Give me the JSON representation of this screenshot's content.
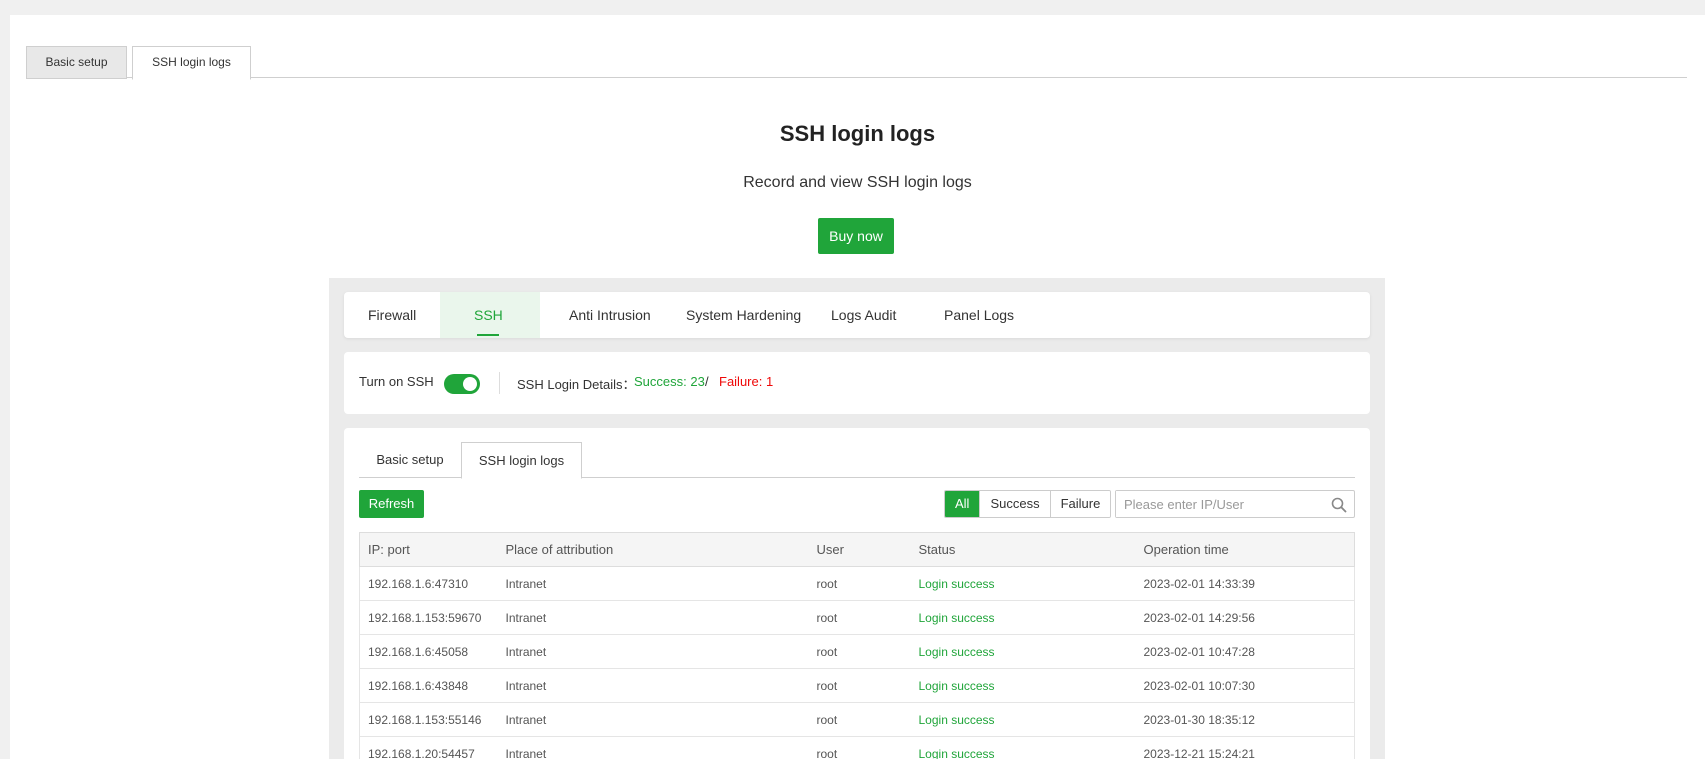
{
  "top_tabs": {
    "basic_setup": "Basic setup",
    "ssh_login_logs": "SSH login logs"
  },
  "hero": {
    "title": "SSH login logs",
    "subtitle": "Record and view SSH login logs",
    "buy_button": "Buy now"
  },
  "nav": {
    "items": [
      "Firewall",
      "SSH",
      "Anti Intrusion",
      "System Hardening",
      "Logs Audit",
      "Panel Logs"
    ],
    "active": "SSH"
  },
  "ssh_status": {
    "toggle_label": "Turn on SSH",
    "toggle_on": true,
    "details_label": "SSH Login Details：",
    "success": "Success: 23",
    "separator": "/",
    "failure": "Failure: 1"
  },
  "inner_tabs": {
    "basic_setup": "Basic setup",
    "ssh_login_logs": "SSH login logs"
  },
  "toolbar": {
    "refresh": "Refresh",
    "filters": [
      "All",
      "Success",
      "Failure"
    ],
    "active_filter": "All",
    "search_placeholder": "Please enter IP/User"
  },
  "table": {
    "headers": [
      "IP: port",
      "Place of attribution",
      "User",
      "Status",
      "Operation time"
    ],
    "rows": [
      [
        "192.168.1.6:47310",
        "Intranet",
        "root",
        "Login success",
        "2023-02-01 14:33:39"
      ],
      [
        "192.168.1.153:59670",
        "Intranet",
        "root",
        "Login success",
        "2023-02-01 14:29:56"
      ],
      [
        "192.168.1.6:45058",
        "Intranet",
        "root",
        "Login success",
        "2023-02-01 10:47:28"
      ],
      [
        "192.168.1.6:43848",
        "Intranet",
        "root",
        "Login success",
        "2023-02-01 10:07:30"
      ],
      [
        "192.168.1.153:55146",
        "Intranet",
        "root",
        "Login success",
        "2023-01-30 18:35:12"
      ],
      [
        "192.168.1.20:54457",
        "Intranet",
        "root",
        "Login success",
        "2023-12-21 15:24:21"
      ]
    ]
  },
  "colors": {
    "accent": "#20a53a",
    "failure": "#ef0808"
  }
}
